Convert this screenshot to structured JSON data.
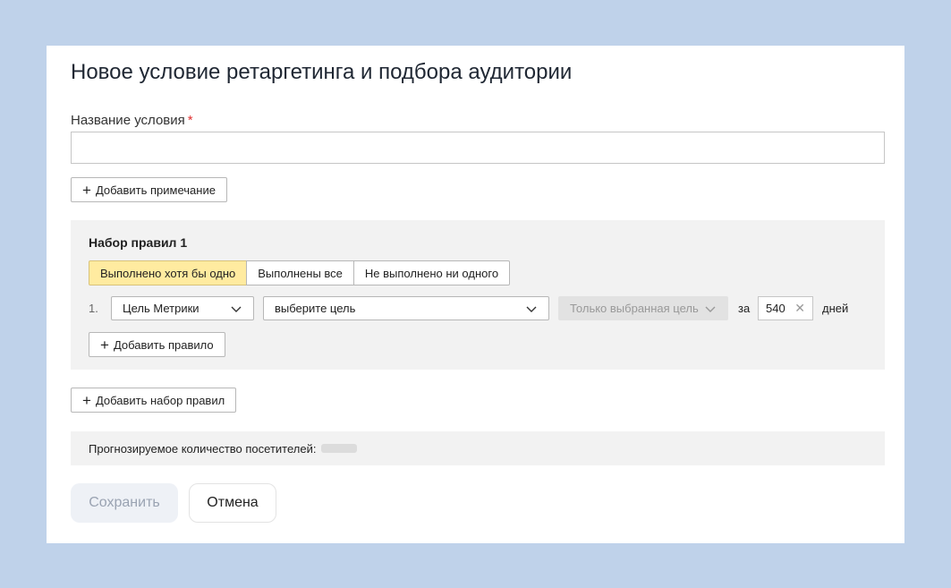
{
  "dialog": {
    "title": "Новое условие ретаргетинга и подбора аудитории",
    "name_label": "Название условия",
    "required_mark": "*",
    "name_value": "",
    "add_note_label": "Добавить примечание"
  },
  "ruleset": {
    "title": "Набор правил 1",
    "modes": [
      "Выполнено хотя бы одно",
      "Выполнены все",
      "Не выполнено ни одного"
    ],
    "active_mode": "Выполнено хотя бы одно",
    "rule": {
      "number": "1.",
      "type_select": "Цель Метрики",
      "goal_select": "выберите цель",
      "scope_select": "Только выбранная цель",
      "za": "за",
      "days_value": "540",
      "days_label": "дней"
    },
    "add_rule_label": "Добавить правило"
  },
  "add_ruleset_label": "Добавить набор правил",
  "forecast": {
    "label": "Прогнозируемое количество посетителей:"
  },
  "footer": {
    "save_label": "Сохранить",
    "cancel_label": "Отмена"
  },
  "icons": {
    "plus": "plus-icon",
    "chevron": "chevron-down-icon",
    "clear": "close-icon"
  },
  "colors": {
    "background": "#bfd2ea",
    "active_mode": "#ffeba0",
    "panel": "#f2f2f2",
    "required": "#e03030"
  }
}
